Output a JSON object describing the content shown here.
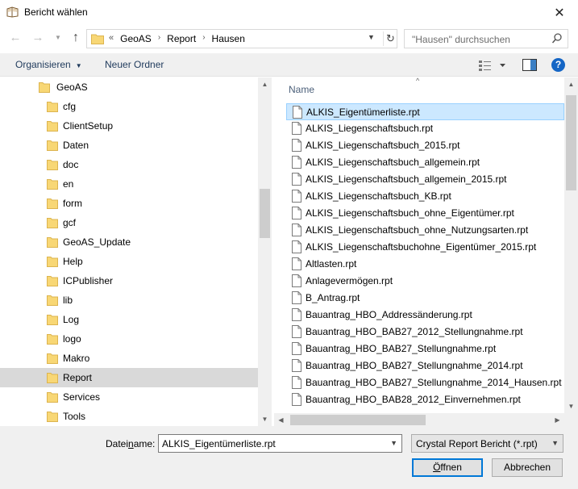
{
  "window": {
    "title": "Bericht wählen",
    "close_glyph": "✕"
  },
  "address": {
    "lead": "«",
    "crumbs": [
      "GeoAS",
      "Report",
      "Hausen"
    ],
    "separator": "›"
  },
  "search": {
    "placeholder": "\"Hausen\" durchsuchen"
  },
  "toolbar": {
    "organize": "Organisieren",
    "new_folder": "Neuer Ordner",
    "help": "?"
  },
  "nav_tree": {
    "root": "GeoAS",
    "items": [
      "cfg",
      "ClientSetup",
      "Daten",
      "doc",
      "en",
      "form",
      "gcf",
      "GeoAS_Update",
      "Help",
      "ICPublisher",
      "lib",
      "Log",
      "logo",
      "Makro",
      "Report",
      "Services",
      "Tools"
    ],
    "selected": "Report"
  },
  "file_list": {
    "column_name": "Name",
    "files": [
      "ALKIS_Eigentümerliste.rpt",
      "ALKIS_Liegenschaftsbuch.rpt",
      "ALKIS_Liegenschaftsbuch_2015.rpt",
      "ALKIS_Liegenschaftsbuch_allgemein.rpt",
      "ALKIS_Liegenschaftsbuch_allgemein_2015.rpt",
      "ALKIS_Liegenschaftsbuch_KB.rpt",
      "ALKIS_Liegenschaftsbuch_ohne_Eigentümer.rpt",
      "ALKIS_Liegenschaftsbuch_ohne_Nutzungsarten.rpt",
      "ALKIS_Liegenschaftsbuchohne_Eigentümer_2015.rpt",
      "Altlasten.rpt",
      "Anlagevermögen.rpt",
      "B_Antrag.rpt",
      "Bauantrag_HBO_Addressänderung.rpt",
      "Bauantrag_HBO_BAB27_2012_Stellungnahme.rpt",
      "Bauantrag_HBO_BAB27_Stellungnahme.rpt",
      "Bauantrag_HBO_BAB27_Stellungnahme_2014.rpt",
      "Bauantrag_HBO_BAB27_Stellungnahme_2014_Hausen.rpt",
      "Bauantrag_HBO_BAB28_2012_Einvernehmen.rpt"
    ],
    "selected_index": 0
  },
  "footer": {
    "filename_label_pre": "Datei",
    "filename_label_u": "n",
    "filename_label_post": "ame:",
    "filename_value": "ALKIS_Eigentümerliste.rpt",
    "filetype_value": "Crystal Report Bericht (*.rpt)",
    "open_u": "Ö",
    "open_rest": "ffnen",
    "cancel": "Abbrechen"
  },
  "colors": {
    "selection_file": "#cce8ff",
    "selection_tree": "#d9d9d9",
    "folder": "#f8d775",
    "accent": "#0078d7"
  }
}
